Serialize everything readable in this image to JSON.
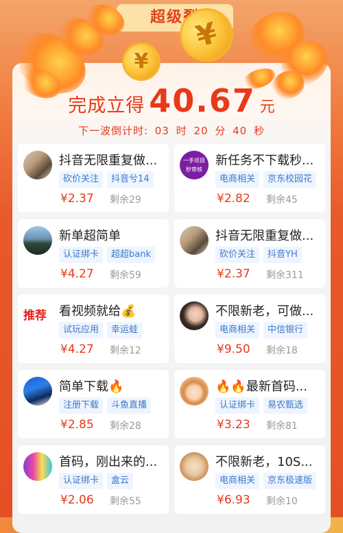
{
  "header": {
    "banner_title": "超级裂",
    "reward_label": "完成立得",
    "reward_amount": "40.67",
    "reward_unit": "元",
    "countdown_label": "下一波倒计时:",
    "countdown_hours": "03",
    "hour_unit": "时",
    "countdown_minutes": "20",
    "minute_unit": "分",
    "countdown_seconds": "40",
    "second_unit": "秒",
    "coin_symbol": "¥"
  },
  "tasks": [
    {
      "title": "抖音无限重复做...",
      "tag1": "砍价关注",
      "tag2": "抖音兮14",
      "price": "¥2.37",
      "remain": "剩余29",
      "avatar": "avatar-room"
    },
    {
      "title": "新任务不下载秒...",
      "tag1": "电商相关",
      "tag2": "京东校园花",
      "price": "¥2.82",
      "remain": "剩余45",
      "avatar": "avatar-purple-badge",
      "avatar_text": "一手项目 秒审核"
    },
    {
      "title": "新单超简单",
      "tag1": "认证绑卡",
      "tag2": "超超bank",
      "price": "¥4.27",
      "remain": "剩余59",
      "avatar": "avatar-landscape"
    },
    {
      "title": "抖音无限重复做...",
      "tag1": "砍价关注",
      "tag2": "抖音YH",
      "price": "¥2.37",
      "remain": "剩余311",
      "avatar": "avatar-room"
    },
    {
      "title": "看视频就给💰",
      "tag1": "试玩应用",
      "tag2": "幸运蛙",
      "price": "¥4.27",
      "remain": "剩余12",
      "avatar": "recommend-badge",
      "badge_text": "推荐"
    },
    {
      "title": "不限新老，可做...",
      "tag1": "电商相关",
      "tag2": "中信银行",
      "price": "¥9.50",
      "remain": "剩余18",
      "avatar": "avatar-girl"
    },
    {
      "title": "简单下载🔥",
      "tag1": "注册下载",
      "tag2": "斗鱼直播",
      "price": "¥2.85",
      "remain": "剩余28",
      "avatar": "avatar-blue-scene"
    },
    {
      "title": "🔥🔥最新首码...",
      "tag1": "认证绑卡",
      "tag2": "易农甄选",
      "price": "¥3.23",
      "remain": "剩余81",
      "avatar": "avatar-cartoon-girl"
    },
    {
      "title": "首码，刚出来的...",
      "tag1": "认证绑卡",
      "tag2": "盒云",
      "price": "¥2.06",
      "remain": "剩余55",
      "avatar": "avatar-colorful"
    },
    {
      "title": "不限新老，10S...",
      "tag1": "电商相关",
      "tag2": "京东极速版",
      "price": "¥6.93",
      "remain": "剩余10",
      "avatar": "avatar-monkey"
    }
  ],
  "colors": {
    "accent": "#e8391a",
    "tag_text": "#3d78c8",
    "tag_bg": "#eef5ff",
    "muted": "#9a9a9a"
  }
}
